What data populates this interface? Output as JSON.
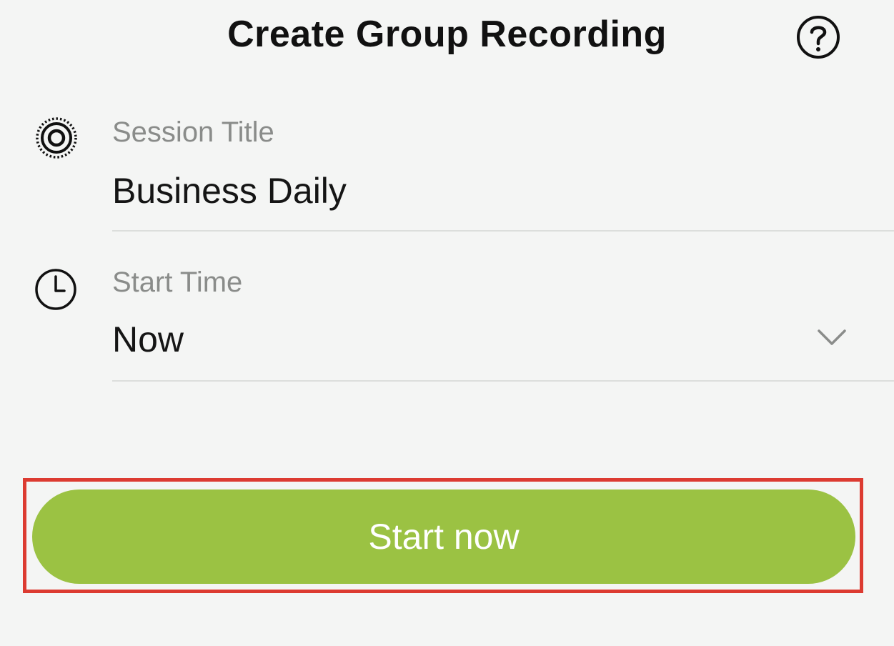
{
  "header": {
    "title": "Create Group Recording",
    "help_icon": "question-circle-icon"
  },
  "form": {
    "session_title": {
      "icon": "broadcast-target-icon",
      "label": "Session Title",
      "value": "Business Daily"
    },
    "start_time": {
      "icon": "clock-icon",
      "label": "Start Time",
      "value": "Now",
      "dropdown_icon": "chevron-down-icon"
    }
  },
  "actions": {
    "start_label": "Start now"
  },
  "colors": {
    "accent": "#9bc243",
    "highlight": "#dc3b31",
    "background": "#f4f5f4"
  }
}
